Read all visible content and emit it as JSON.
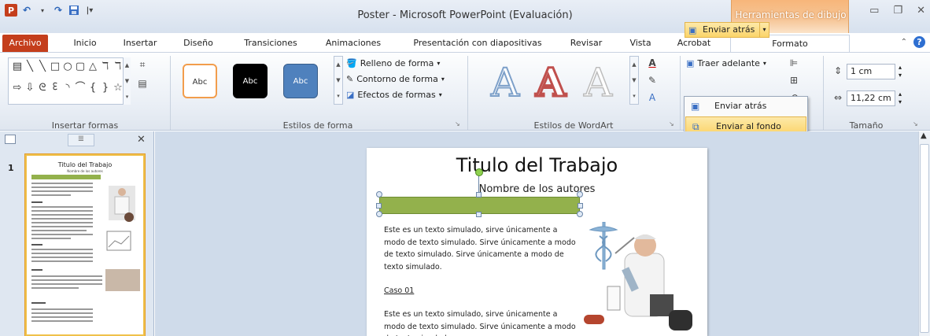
{
  "window": {
    "title": "Poster - Microsoft PowerPoint (Evaluación)",
    "context_tab_group": "Herramientas de dibujo"
  },
  "quick_access": {
    "app_icon": "powerpoint-icon",
    "undo_icon": "undo-icon",
    "redo_icon": "redo-icon",
    "save_icon": "save-icon",
    "customize_icon": "customize-qat-icon"
  },
  "tabs": [
    "Archivo",
    "Inicio",
    "Insertar",
    "Diseño",
    "Transiciones",
    "Animaciones",
    "Presentación con diapositivas",
    "Revisar",
    "Vista",
    "Acrobat",
    "Formato"
  ],
  "ribbon": {
    "insert_shapes_label": "Insertar formas",
    "shape_styles_label": "Estilos de forma",
    "style_swatches": [
      "Abc",
      "Abc",
      "Abc"
    ],
    "shape_fill": "Relleno de forma",
    "shape_outline": "Contorno de forma",
    "shape_effects": "Efectos de formas",
    "wordart_label": "Estilos de WordArt",
    "wordart_sample": "A",
    "bring_forward": "Traer adelante",
    "send_backward": "Enviar atrás",
    "size_label": "Tamaño",
    "height_value": "1 cm",
    "width_value": "11,22 cm"
  },
  "dropdown": {
    "items": [
      "Enviar atrás",
      "Enviar al fondo"
    ]
  },
  "thumbnail": {
    "number": "1",
    "title": "Titulo del Trabajo",
    "subtitle": "Nombre de los autores",
    "section_1": "Caso 01",
    "section_2": "Caso 02",
    "section_3": "Conclusión"
  },
  "slide": {
    "title": "Titulo del Trabajo",
    "authors": "Nombre de los autores",
    "para_1": "Este es un texto simulado, sirve únicamente a modo de texto simulado. Sirve únicamente a modo de texto simulado. Sirve únicamente a modo de texto simulado.",
    "section_1": "Caso 01",
    "para_2": "Este es un texto simulado, sirve únicamente a modo de texto simulado. Sirve únicamente a modo de texto simulado."
  },
  "colors": {
    "accent": "#c43e1c",
    "context_tab": "#f6c698",
    "selection": "#fbd469",
    "shape_fill": "#93b14c"
  }
}
